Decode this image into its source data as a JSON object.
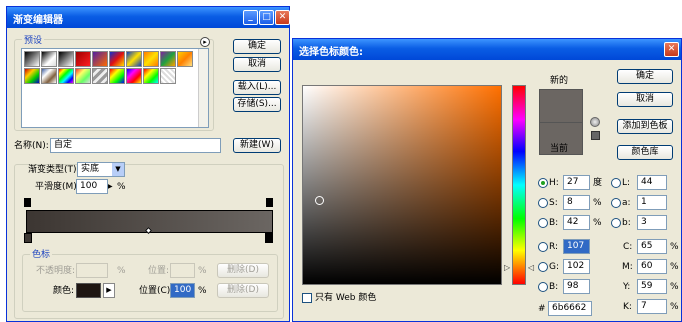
{
  "gradient_editor": {
    "title": "渐变编辑器",
    "presets_label": "预设",
    "ok": "确定",
    "cancel": "取消",
    "load": "载入(L)...",
    "save": "存储(S)...",
    "name_label": "名称(N):",
    "name_value": "自定",
    "new_button": "新建(W)",
    "type_label": "渐变类型(T):",
    "type_value": "实底",
    "smooth_label": "平滑度(M):",
    "smooth_value": "100",
    "percent": "%",
    "stops_label": "色标",
    "opacity_label": "不透明度:",
    "location_label": "位置:",
    "delete": "删除(D)",
    "color_label": "颜色:",
    "location_c_label": "位置(C):",
    "location_c_value": "100",
    "gradient_start_color": "#3c3632",
    "gradient_end_color": "#6b6662"
  },
  "color_picker": {
    "title": "选择色标颜色:",
    "new_label": "新的",
    "current_label": "当前",
    "ok": "确定",
    "cancel": "取消",
    "add_swatch": "添加到色板",
    "libraries": "颜色库",
    "web_only": "只有 Web 颜色",
    "h_label": "H:",
    "h_value": "27",
    "h_unit": "度",
    "s_label": "S:",
    "s_value": "8",
    "s_unit": "%",
    "b_label": "B:",
    "b_value": "42",
    "b_unit": "%",
    "r_label": "R:",
    "r_value": "107",
    "g_label": "G:",
    "g_value": "102",
    "bl_label": "B:",
    "bl_value": "98",
    "l_label": "L:",
    "l_value": "44",
    "a_label": "a:",
    "a_value": "1",
    "lab_b_label": "b:",
    "lab_b_value": "3",
    "c_label": "C:",
    "c_value": "65",
    "m_label": "M:",
    "m_value": "60",
    "y_label": "Y:",
    "y_value": "59",
    "k_label": "K:",
    "k_value": "7",
    "cmyk_unit": "%",
    "hex_label": "#",
    "hex_value": "6b6662",
    "new_color": "#6b6662",
    "current_color": "#6b6662",
    "field_hue_color": "#ff7000"
  }
}
